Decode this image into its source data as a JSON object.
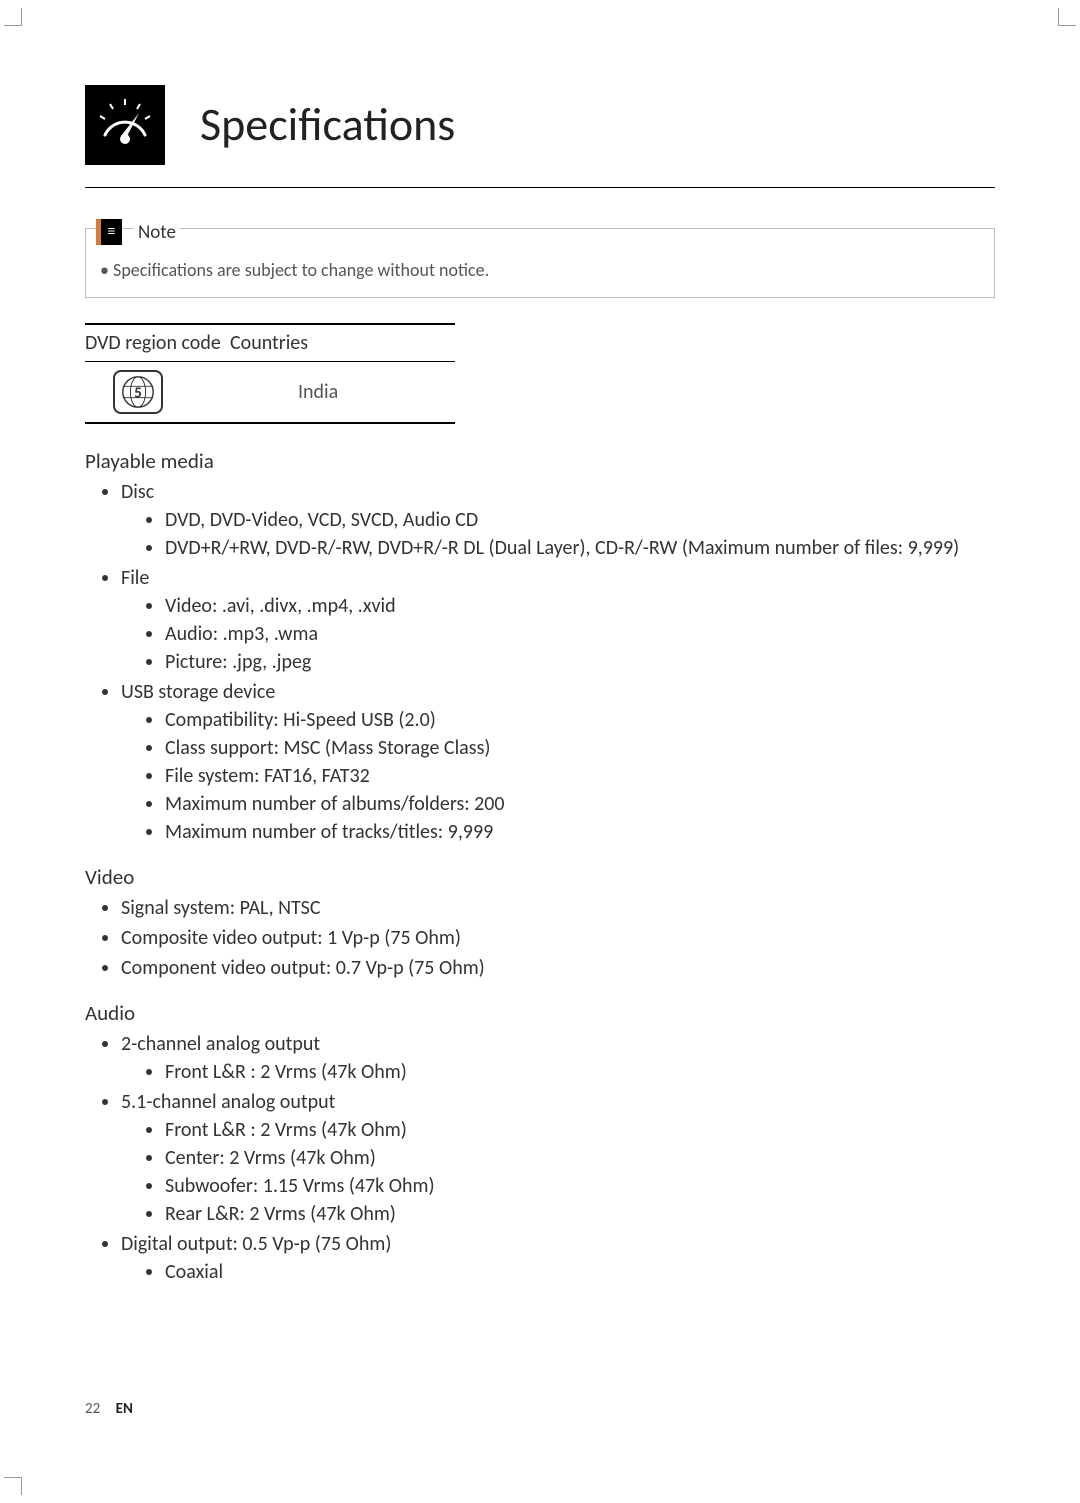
{
  "header": {
    "title": "Specifications"
  },
  "note": {
    "label": "Note",
    "text": "Specifications are subject to change without notice."
  },
  "region_table": {
    "col1": "DVD region code",
    "col2": "Countries",
    "region_number": "5",
    "country": "India"
  },
  "playable_media": {
    "heading": "Playable media",
    "disc_label": "Disc",
    "disc_items": [
      "DVD, DVD-Video, VCD, SVCD, Audio CD",
      "DVD+R/+RW, DVD-R/-RW, DVD+R/-R DL (Dual Layer), CD-R/-RW (Maximum number of files: 9,999)"
    ],
    "file_label": "File",
    "file_items": [
      "Video: .avi, .divx, .mp4, .xvid",
      "Audio: .mp3, .wma",
      "Picture: .jpg, .jpeg"
    ],
    "usb_label": "USB storage device",
    "usb_items": [
      "Compatibility: Hi-Speed USB (2.0)",
      "Class support: MSC (Mass Storage Class)",
      "File system: FAT16, FAT32",
      "Maximum number of albums/folders: 200",
      "Maximum number of tracks/titles: 9,999"
    ]
  },
  "video": {
    "heading": "Video",
    "items": [
      "Signal system: PAL, NTSC",
      "Composite video output: 1 Vp-p (75 Ohm)",
      "Component video output: 0.7 Vp-p (75 Ohm)"
    ]
  },
  "audio": {
    "heading": "Audio",
    "two_ch": "2-channel analog output",
    "two_ch_items": [
      "Front L&R : 2 Vrms (47k Ohm)"
    ],
    "five_ch": "5.1-channel analog output",
    "five_ch_items": [
      "Front L&R : 2 Vrms (47k Ohm)",
      "Center: 2 Vrms (47k Ohm)",
      "Subwoofer: 1.15 Vrms (47k Ohm)",
      "Rear L&R: 2 Vrms (47k Ohm)"
    ],
    "digital": "Digital output: 0.5 Vp-p (75 Ohm)",
    "digital_items": [
      "Coaxial"
    ]
  },
  "footer": {
    "page": "22",
    "lang": "EN"
  }
}
